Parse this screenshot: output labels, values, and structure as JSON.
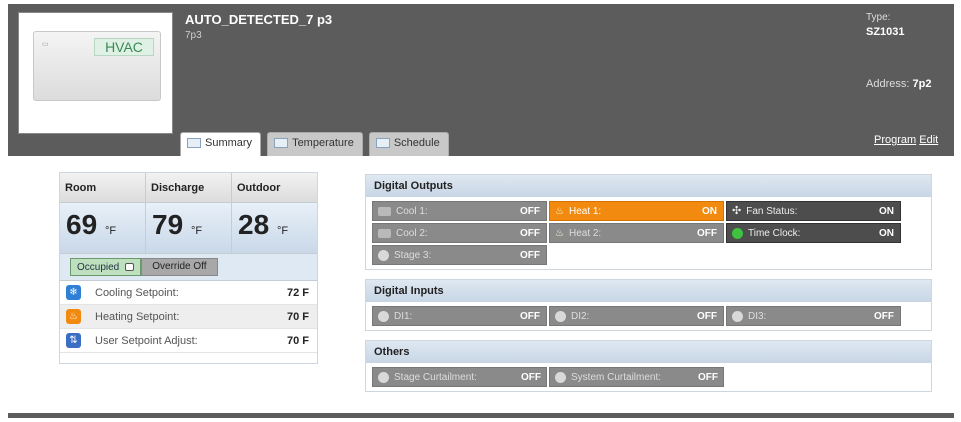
{
  "device": {
    "thumbnail_label": "HVAC",
    "title": "AUTO_DETECTED_7 p3",
    "subtitle": "7p3",
    "type_label": "Type:",
    "type_value": "SZ1031",
    "address_label": "Address:",
    "address_value": "7p2"
  },
  "tabs": [
    {
      "label": "Summary",
      "active": true
    },
    {
      "label": "Temperature",
      "active": false
    },
    {
      "label": "Schedule",
      "active": false
    }
  ],
  "links": {
    "program": "Program",
    "edit": "Edit"
  },
  "temperatures": [
    {
      "label": "Room",
      "value": "69",
      "unit": "°F"
    },
    {
      "label": "Discharge",
      "value": "79",
      "unit": "°F"
    },
    {
      "label": "Outdoor",
      "value": "28",
      "unit": "°F"
    }
  ],
  "occupancy": {
    "occupied_label": "Occupied",
    "override_label": "Override Off"
  },
  "setpoints": [
    {
      "label": "Cooling Setpoint:",
      "value": "72 F",
      "icon": "snowflake-icon",
      "color": "#2f7fd6"
    },
    {
      "label": "Heating Setpoint:",
      "value": "70 F",
      "icon": "flame-icon",
      "color": "#f28a10"
    },
    {
      "label": "User Setpoint Adjust:",
      "value": "70 F",
      "icon": "adjust-icon",
      "color": "#3b6fc4"
    }
  ],
  "digital_outputs": {
    "title": "Digital Outputs",
    "items": [
      {
        "label": "Cool 1:",
        "status": "OFF",
        "style": "off",
        "icon": "cool-icon"
      },
      {
        "label": "Heat 1:",
        "status": "ON",
        "style": "on",
        "icon": "heat-icon"
      },
      {
        "label": "Fan Status:",
        "status": "ON",
        "style": "dark",
        "icon": "fan-icon"
      },
      {
        "label": "Cool 2:",
        "status": "OFF",
        "style": "off",
        "icon": "cool-icon"
      },
      {
        "label": "Heat 2:",
        "status": "OFF",
        "style": "off",
        "icon": "heat-icon"
      },
      {
        "label": "Time Clock:",
        "status": "ON",
        "style": "dark",
        "icon": "clock-icon"
      },
      {
        "label": "Stage 3:",
        "status": "OFF",
        "style": "off",
        "icon": "stage-icon"
      }
    ]
  },
  "digital_inputs": {
    "title": "Digital Inputs",
    "items": [
      {
        "label": "DI1:",
        "status": "OFF"
      },
      {
        "label": "DI2:",
        "status": "OFF"
      },
      {
        "label": "DI3:",
        "status": "OFF"
      }
    ]
  },
  "others": {
    "title": "Others",
    "items": [
      {
        "label": "Stage Curtailment:",
        "status": "OFF"
      },
      {
        "label": "System Curtailment:",
        "status": "OFF"
      }
    ]
  },
  "colors": {
    "accent_on": "#f28a10",
    "header_bg": "#5c5c5c",
    "section_header": "#c7d5e4"
  }
}
